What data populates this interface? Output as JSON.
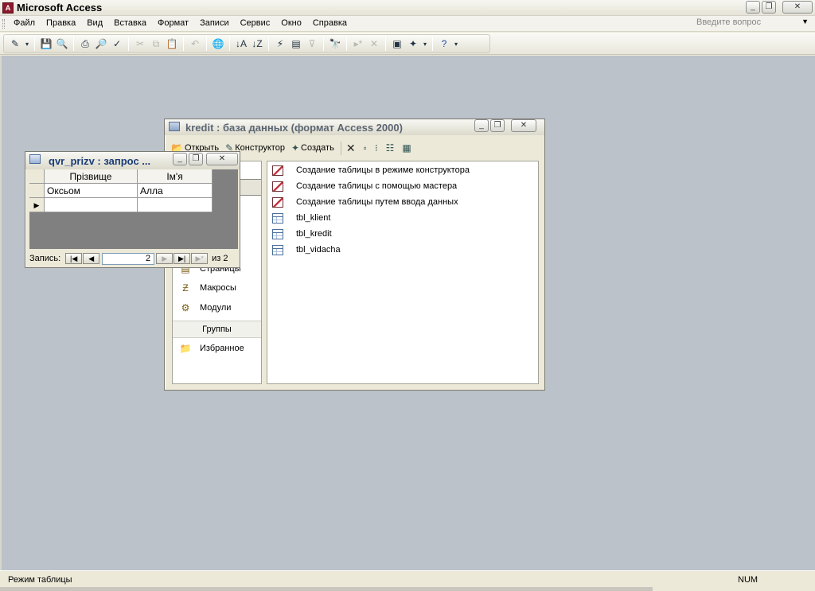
{
  "app": {
    "title": "Microsoft Access",
    "logo": "A"
  },
  "menu": {
    "items": [
      "Файл",
      "Правка",
      "Вид",
      "Вставка",
      "Формат",
      "Записи",
      "Сервис",
      "Окно",
      "Справка"
    ],
    "ask_placeholder": "Введите вопрос"
  },
  "db_window": {
    "title": "kredit : база данных (формат Access 2000)",
    "toolbar": {
      "open": "Открыть",
      "design": "Конструктор",
      "create": "Создать"
    },
    "objects": [
      {
        "label": "Страницы",
        "icon": "page-icon"
      },
      {
        "label": "Макросы",
        "icon": "macro-icon"
      },
      {
        "label": "Модули",
        "icon": "module-icon"
      }
    ],
    "groups_label": "Группы",
    "favorites_label": "Избранное",
    "items": [
      {
        "label": "Создание таблицы в режиме конструктора",
        "icon": "wizard-icon"
      },
      {
        "label": "Создание таблицы с помощью мастера",
        "icon": "wizard-icon"
      },
      {
        "label": "Создание таблицы путем ввода данных",
        "icon": "wizard-icon"
      },
      {
        "label": "tbl_klient",
        "icon": "table-icon"
      },
      {
        "label": "tbl_kredit",
        "icon": "table-icon"
      },
      {
        "label": "tbl_vidacha",
        "icon": "table-icon"
      }
    ]
  },
  "query_window": {
    "title": "qvr_prizv : запрос ...",
    "columns": [
      "Прізвище",
      "Ім'я"
    ],
    "rows": [
      [
        "Оксьом",
        "Алла"
      ]
    ],
    "nav": {
      "record_label": "Запись:",
      "current": "2",
      "of_label": "из 2"
    }
  },
  "status": {
    "mode": "Режим таблицы",
    "num": "NUM"
  }
}
